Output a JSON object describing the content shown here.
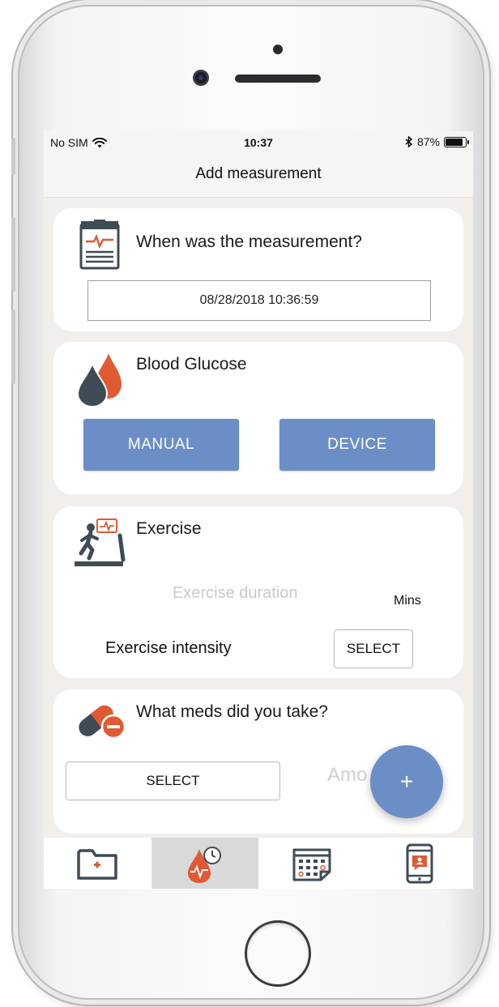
{
  "status_bar": {
    "carrier": "No SIM",
    "time": "10:37",
    "battery_percent": "87%",
    "battery_level": 0.87
  },
  "nav": {
    "title": "Add measurement"
  },
  "measurement_time": {
    "question": "When was the measurement?",
    "datetime_value": "08/28/2018 10:36:59",
    "icon": "clipboard-chart-icon"
  },
  "blood_glucose": {
    "title": "Blood Glucose",
    "manual_label": "MANUAL",
    "device_label": "DEVICE",
    "icon": "blood-drops-icon"
  },
  "exercise": {
    "title": "Exercise",
    "duration_placeholder": "Exercise duration",
    "duration_unit": "Mins",
    "intensity_label": "Exercise intensity",
    "intensity_select_label": "SELECT",
    "icon": "treadmill-icon"
  },
  "meds": {
    "question": "What meds did you take?",
    "select_label": "SELECT",
    "amount_placeholder": "Amo",
    "icon": "pill-capsule-icon"
  },
  "fab": {
    "label": "+"
  },
  "tabs": [
    {
      "name": "medical-record-tab",
      "icon": "medical-folder-icon"
    },
    {
      "name": "measurement-tab",
      "icon": "blood-timer-icon",
      "active": true
    },
    {
      "name": "calendar-tab",
      "icon": "calendar-icon"
    },
    {
      "name": "remote-care-tab",
      "icon": "phone-chat-icon"
    }
  ],
  "colors": {
    "accent_blue": "#6b8ec6",
    "accent_red": "#e05a34",
    "icon_dark": "#3f4b55",
    "screen_bg": "#f1eeeb"
  }
}
